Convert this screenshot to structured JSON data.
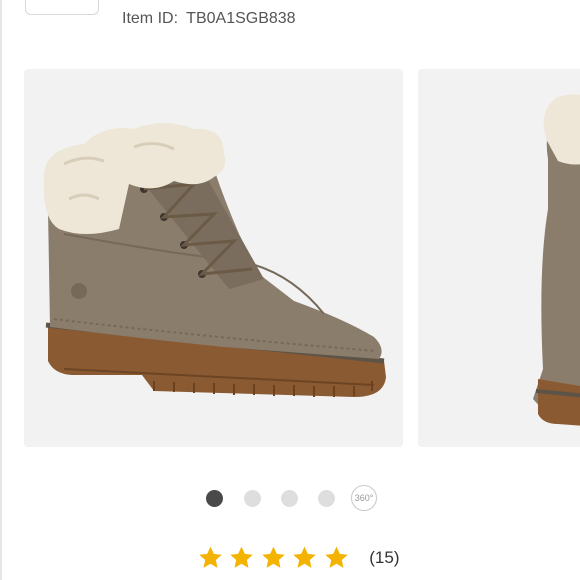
{
  "product": {
    "item_id_label": "Item ID:",
    "item_id_value": "TB0A1SGB838"
  },
  "gallery": {
    "slide_count": 5,
    "active_index": 0,
    "view_360_label": "360°"
  },
  "rating": {
    "stars": 5,
    "review_count": "(15)"
  },
  "colors": {
    "star": "#f5b301",
    "active_dot": "#4a4a4a",
    "inactive_dot": "#dedede",
    "image_bg": "#f2f2f2"
  }
}
